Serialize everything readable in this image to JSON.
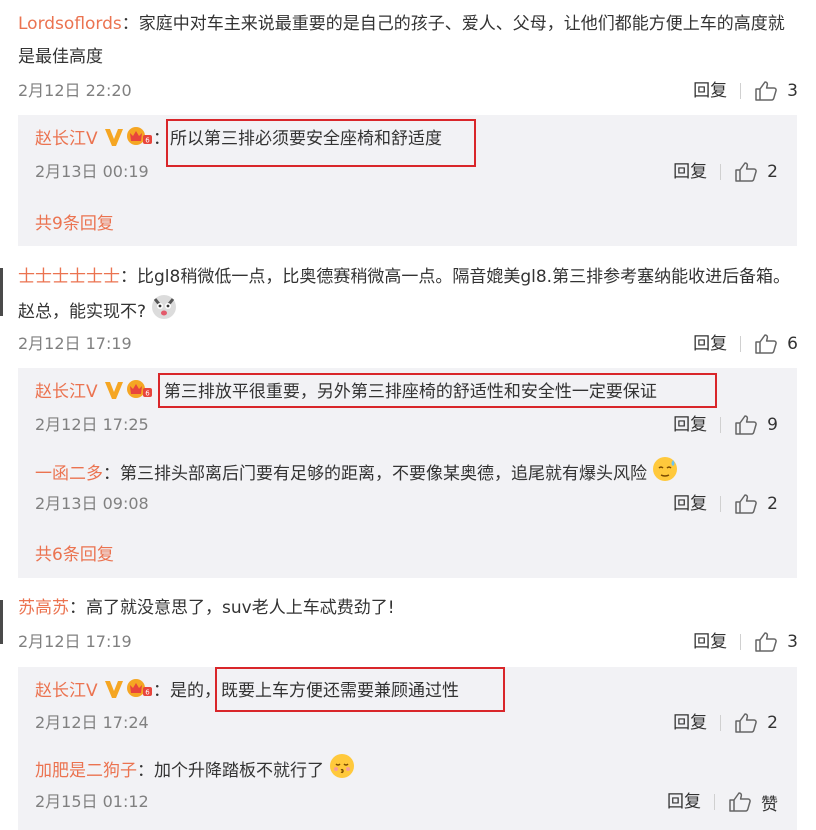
{
  "comments": [
    {
      "user": "Lordsoflords",
      "text": "：家庭中对车主来说最重要的是自己的孩子、爱人、父母，让他们都能方便上车的高度就是最佳高度",
      "time": "2月12日 22:20",
      "reply_label": "回复",
      "likes": "3",
      "replies": [
        {
          "user": "赵长江V",
          "text": "所以第三排必须要安全座椅和舒适度",
          "time": "2月13日 00:19",
          "reply_label": "回复",
          "likes": "2"
        }
      ],
      "more_replies": "共9条回复"
    },
    {
      "user": "士士士士士士",
      "text": "：比gl8稍微低一点，比奥德赛稍微高一点。隔音媲美gl8.第三排参考塞纳能收进后备箱。赵总，能实现不?",
      "time": "2月12日 17:19",
      "reply_label": "回复",
      "likes": "6",
      "replies": [
        {
          "user": "赵长江V",
          "text": "第三排放平很重要，另外第三排座椅的舒适性和安全性一定要保证",
          "time": "2月12日 17:25",
          "reply_label": "回复",
          "likes": "9"
        },
        {
          "user": "一函二多",
          "text": "：第三排头部离后门要有足够的距离，不要像某奥德，追尾就有爆头风险",
          "time": "2月13日 09:08",
          "reply_label": "回复",
          "likes": "2"
        }
      ],
      "more_replies": "共6条回复"
    },
    {
      "user": "苏高苏",
      "text": "：高了就没意思了，suv老人上车忒费劲了!",
      "time": "2月12日 17:19",
      "reply_label": "回复",
      "likes": "3",
      "replies": [
        {
          "user": "赵长江V",
          "text_prefix": "：是的，",
          "text": "既要上车方便还需要兼顾通过性",
          "time": "2月12日 17:24",
          "reply_label": "回复",
          "likes": "2"
        },
        {
          "user": "加肥是二狗子",
          "text": "：加个升降踏板不就行了",
          "time": "2月15日 01:12",
          "reply_label": "回复",
          "likes": "赞"
        }
      ]
    }
  ],
  "colors": {
    "username": "#eb7350",
    "highlight_box": "#d9262a",
    "reply_bg": "#f2f2f5"
  },
  "icons": [
    "thumbs-up-icon",
    "verified-v-icon",
    "vip-crown-icon",
    "husky-emoji-icon",
    "sweat-emoji-icon",
    "kiss-emoji-icon"
  ]
}
